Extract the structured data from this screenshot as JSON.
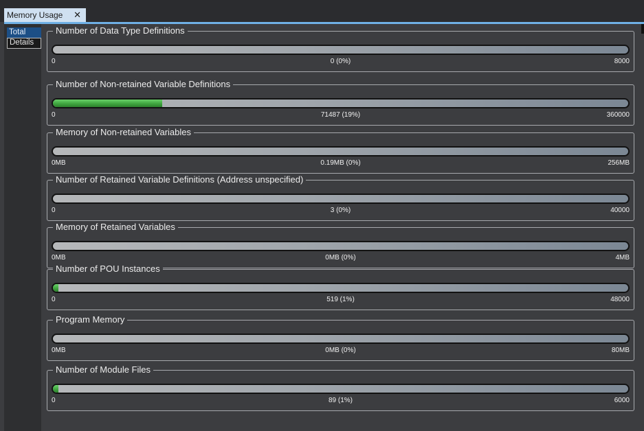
{
  "tab": {
    "label": "Memory Usage",
    "close_glyph": "✕"
  },
  "sidebar": {
    "items": [
      {
        "label": "Total"
      },
      {
        "label": "Details"
      }
    ]
  },
  "groups": [
    {
      "title": "Number of Data Type Definitions",
      "min": "0",
      "value": "0 (0%)",
      "max": "8000",
      "fill_percent": 0
    },
    {
      "title": "Number of Non-retained Variable Definitions",
      "min": "0",
      "value": "71487 (19%)",
      "max": "360000",
      "fill_percent": 19
    },
    {
      "title": "Memory of Non-retained Variables",
      "min": "0MB",
      "value": "0.19MB (0%)",
      "max": "256MB",
      "fill_percent": 0
    },
    {
      "title": "Number of Retained Variable Definitions (Address unspecified)",
      "min": "0",
      "value": "3 (0%)",
      "max": "40000",
      "fill_percent": 0
    },
    {
      "title": "Memory of Retained Variables",
      "min": "0MB",
      "value": "0MB (0%)",
      "max": "4MB",
      "fill_percent": 0
    },
    {
      "title": "Number of POU Instances",
      "min": "0",
      "value": "519 (1%)",
      "max": "48000",
      "fill_percent": 1
    },
    {
      "title": "Program Memory",
      "min": "0MB",
      "value": "0MB (0%)",
      "max": "80MB",
      "fill_percent": 0
    },
    {
      "title": "Number of Module Files",
      "min": "0",
      "value": "89 (1%)",
      "max": "6000",
      "fill_percent": 1
    }
  ],
  "colors": {
    "fill": "#3fa63f",
    "selected_tab": "#1c4f86",
    "tab_underline": "#6fb0e5"
  },
  "icons": {
    "close": "close-icon"
  }
}
